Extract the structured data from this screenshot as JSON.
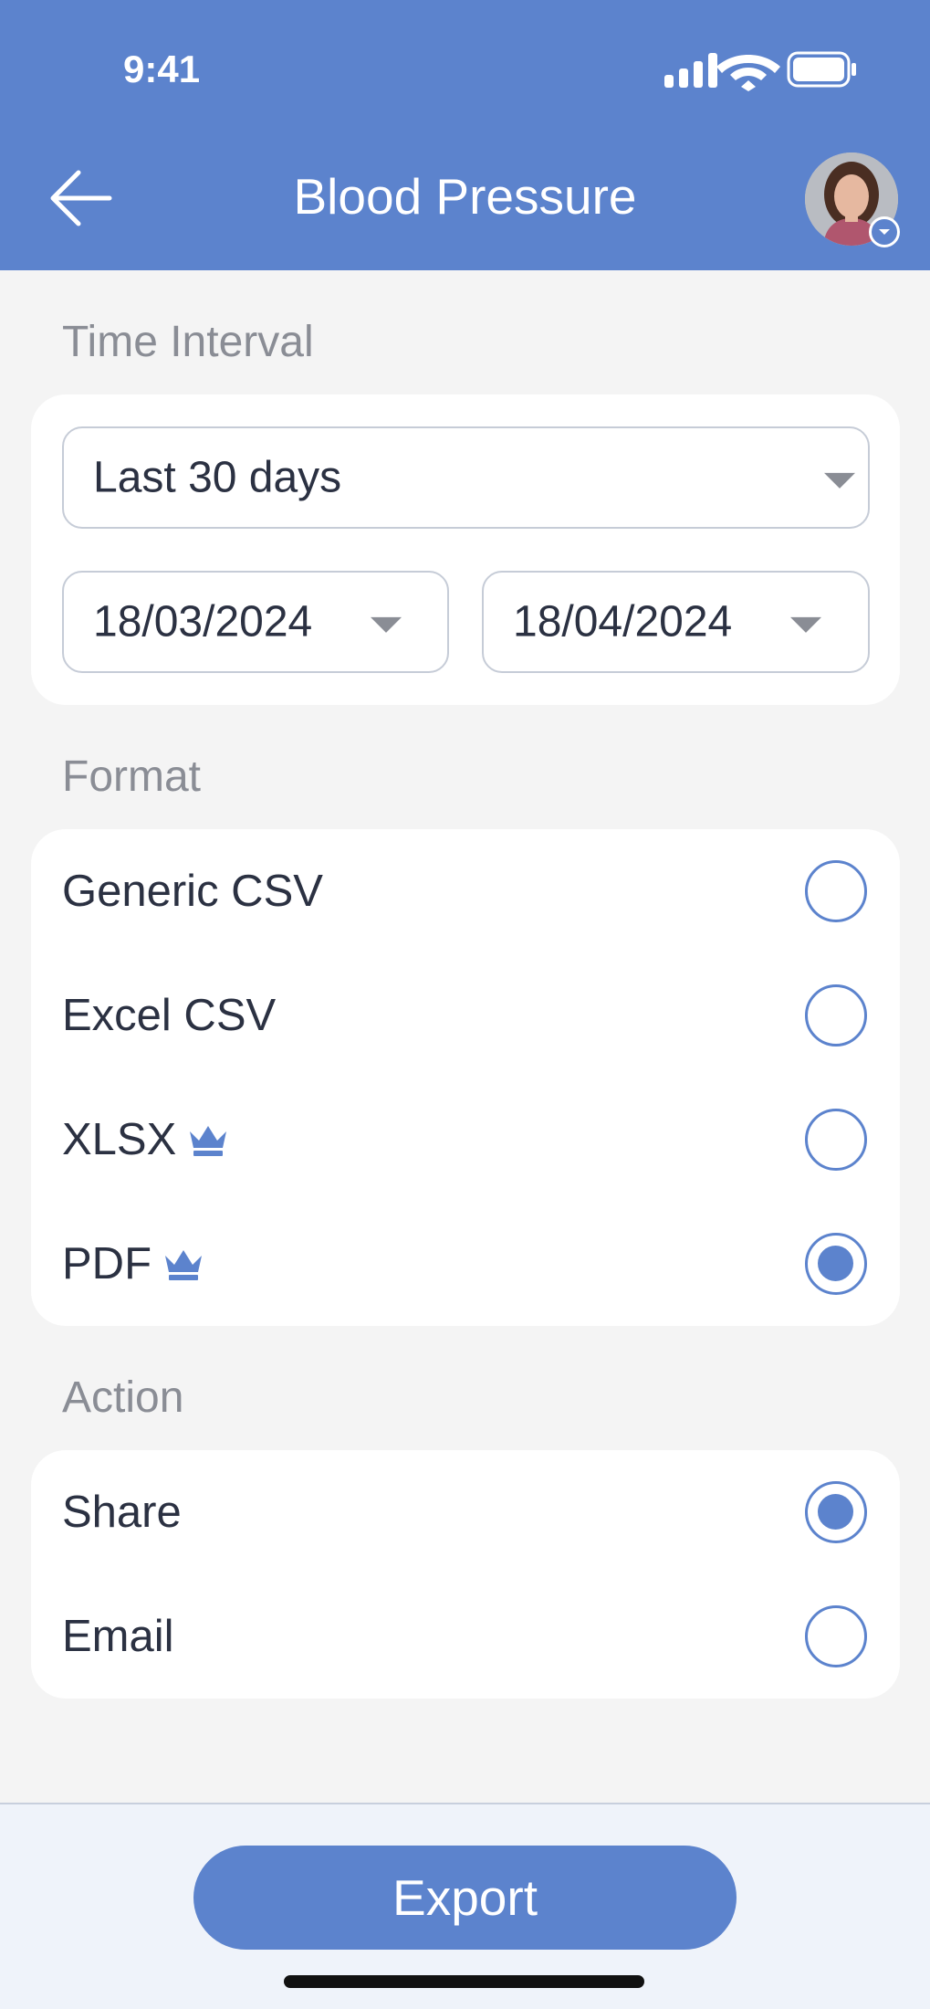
{
  "status_bar": {
    "time": "9:41"
  },
  "header": {
    "title": "Blood Pressure"
  },
  "time_interval": {
    "label": "Time Interval",
    "preset": "Last 30 days",
    "start_date": "18/03/2024",
    "end_date": "18/04/2024"
  },
  "format": {
    "label": "Format",
    "options": [
      {
        "label": "Generic CSV",
        "premium": false,
        "selected": false
      },
      {
        "label": "Excel CSV",
        "premium": false,
        "selected": false
      },
      {
        "label": "XLSX",
        "premium": true,
        "selected": false
      },
      {
        "label": "PDF",
        "premium": true,
        "selected": true
      }
    ]
  },
  "action": {
    "label": "Action",
    "options": [
      {
        "label": "Share",
        "selected": true
      },
      {
        "label": "Email",
        "selected": false
      }
    ]
  },
  "footer": {
    "export_label": "Export"
  },
  "colors": {
    "accent": "#5c83cd",
    "background": "#f4f4f4",
    "footer_bg": "#eff3fa"
  }
}
